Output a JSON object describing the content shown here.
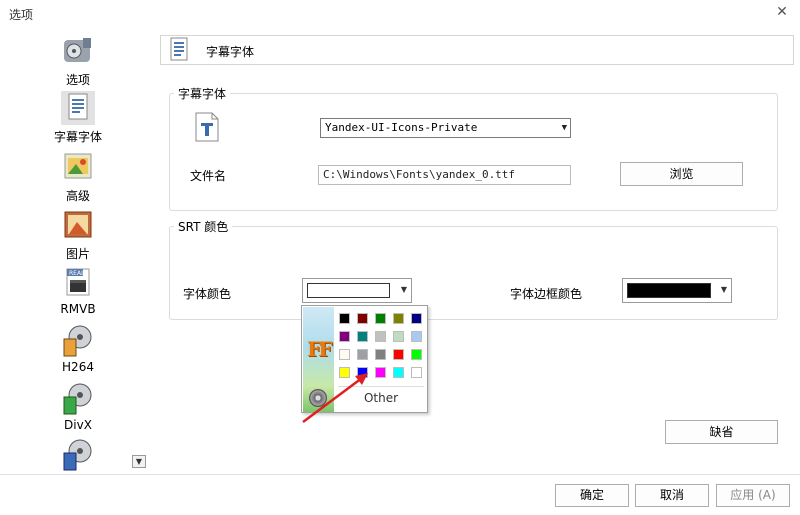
{
  "window": {
    "title": "选项",
    "close_glyph": "✕"
  },
  "sidebar": {
    "items": [
      {
        "label": "选项",
        "icon": "options-film-icon"
      },
      {
        "label": "字幕字体",
        "icon": "subtitle-doc-icon",
        "active": true
      },
      {
        "label": "高级",
        "icon": "advanced-image-icon"
      },
      {
        "label": "图片",
        "icon": "picture-icon"
      },
      {
        "label": "RMVB",
        "icon": "rmvb-clapper-icon",
        "badge": "REAL"
      },
      {
        "label": "H264",
        "icon": "h264-reel-icon"
      },
      {
        "label": "DivX",
        "icon": "divx-reel-icon"
      },
      {
        "label": "",
        "icon": "more-reel-icon"
      }
    ],
    "scroll_glyph": "▼"
  },
  "header": {
    "title": "字幕字体"
  },
  "font_group": {
    "title": "字幕字体",
    "font_select": "Yandex-UI-Icons-Private",
    "filename_label": "文件名",
    "filename_value": "C:\\Windows\\Fonts\\yandex_0.ttf",
    "browse_label": "浏览"
  },
  "srt_group": {
    "title": "SRT 颜色",
    "font_color_label": "字体颜色",
    "font_color_value": "#ffffff",
    "border_color_label": "字体边框颜色",
    "border_color_value": "#000000"
  },
  "color_popup": {
    "colors": [
      "#000000",
      "#800000",
      "#008000",
      "#808000",
      "#000080",
      "#800080",
      "#008080",
      "#c0c0c0",
      "#c0dcc0",
      "#a6caf0",
      "#fffbf0",
      "#a0a0a4",
      "#808080",
      "#ff0000",
      "#00ff00",
      "#ffff00",
      "#0000ff",
      "#ff00ff",
      "#00ffff",
      "#ffffff"
    ],
    "other_label": "Other",
    "logo_text": "FF"
  },
  "buttons": {
    "default_label": "缺省",
    "ok_label": "确定",
    "cancel_label": "取消",
    "apply_label": "应用 (A)"
  },
  "colors": {
    "arrow": "#e02020"
  }
}
